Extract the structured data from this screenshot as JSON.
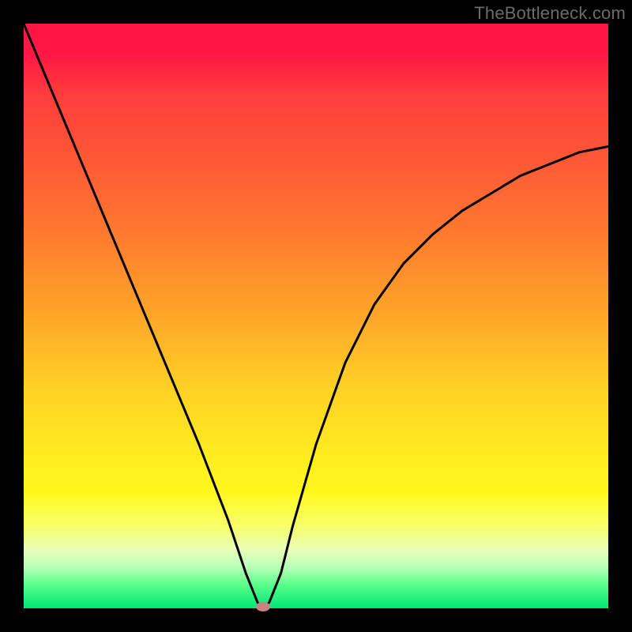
{
  "watermark_text": "TheBottleneck.com",
  "chart_data": {
    "type": "line",
    "title": "",
    "xlabel": "",
    "ylabel": "",
    "xlim": [
      0,
      100
    ],
    "ylim": [
      0,
      100
    ],
    "grid": false,
    "series": [
      {
        "name": "bottleneck-curve",
        "x": [
          0,
          5,
          10,
          15,
          20,
          25,
          30,
          35,
          38,
          40,
          41,
          42,
          44,
          46,
          50,
          55,
          60,
          65,
          70,
          75,
          80,
          85,
          90,
          95,
          100
        ],
        "values": [
          100,
          88,
          76,
          64,
          52,
          40,
          28,
          15,
          6,
          1,
          0,
          1,
          6,
          14,
          28,
          42,
          52,
          59,
          64,
          68,
          71,
          74,
          76,
          78,
          79
        ]
      }
    ],
    "marker": {
      "x": 41,
      "y": 0,
      "color": "#c98282"
    },
    "background_gradient": {
      "top": "#ff1744",
      "bottom": "#00e676",
      "stops": [
        "#ff1744",
        "#ff5a36",
        "#ffa628",
        "#ffe820",
        "#fff81c",
        "#b8ffb8",
        "#00e676"
      ]
    }
  }
}
